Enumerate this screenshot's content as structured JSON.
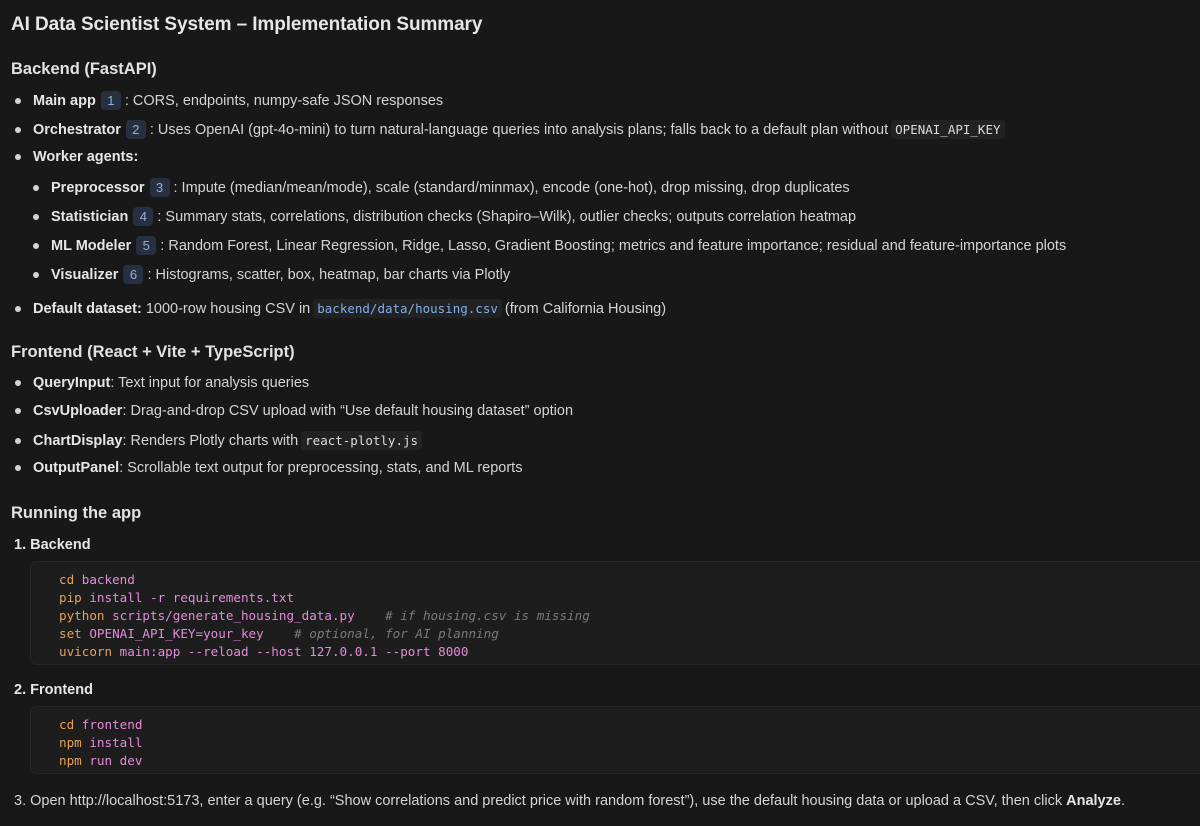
{
  "title": "AI Data Scientist System – Implementation Summary",
  "backend": {
    "heading": "Backend (FastAPI)",
    "items": [
      {
        "label": "Main app",
        "ref": "1",
        "text": ": CORS, endpoints, numpy-safe JSON responses"
      },
      {
        "label": "Orchestrator",
        "ref": "2",
        "text": ": Uses OpenAI (gpt-4o-mini) to turn natural-language queries into analysis plans; falls back to a default plan without",
        "code": "OPENAI_API_KEY"
      },
      {
        "label": "Worker agents:"
      }
    ],
    "workers": [
      {
        "label": "Preprocessor",
        "ref": "3",
        "text": ": Impute (median/mean/mode), scale (standard/minmax), encode (one-hot), drop missing, drop duplicates"
      },
      {
        "label": "Statistician",
        "ref": "4",
        "text": ": Summary stats, correlations, distribution checks (Shapiro–Wilk), outlier checks; outputs correlation heatmap"
      },
      {
        "label": "ML Modeler",
        "ref": "5",
        "text": ": Random Forest, Linear Regression, Ridge, Lasso, Gradient Boosting; metrics and feature importance; residual and feature-importance plots"
      },
      {
        "label": "Visualizer",
        "ref": "6",
        "text": ": Histograms, scatter, box, heatmap, bar charts via Plotly"
      }
    ],
    "dataset": {
      "label": "Default dataset:",
      "text1": "1000-row housing CSV in",
      "code": "backend/data/housing.csv",
      "text2": "(from California Housing)"
    }
  },
  "frontend": {
    "heading": "Frontend (React + Vite + TypeScript)",
    "items": [
      {
        "label": "QueryInput",
        "text": ": Text input for analysis queries"
      },
      {
        "label": "CsvUploader",
        "text": ": Drag-and-drop CSV upload with “Use default housing dataset” option"
      },
      {
        "label": "ChartDisplay",
        "text": ": Renders Plotly charts with",
        "code": "react-plotly.js"
      },
      {
        "label": "OutputPanel",
        "text": ": Scrollable text output for preprocessing, stats, and ML reports"
      }
    ]
  },
  "running": {
    "heading": "Running the app",
    "step1": "1. Backend",
    "backend_code": [
      {
        "cmd": "cd backend",
        "comment": ""
      },
      {
        "cmd": "pip install -r requirements.txt",
        "comment": ""
      },
      {
        "cmd": "python scripts/generate_housing_data.py",
        "comment": "# if housing.csv is missing"
      },
      {
        "cmd": "set OPENAI_API_KEY=your_key",
        "comment": "# optional, for AI planning"
      },
      {
        "cmd": "uvicorn main:app --reload --host 127.0.0.1 --port 8000",
        "comment": ""
      }
    ],
    "step2": "2. Frontend",
    "frontend_code": [
      "cd frontend",
      "npm install",
      "npm run dev"
    ],
    "step3_text": "3. Open http://localhost:5173, enter a query (e.g. “Show correlations and predict price with random forest”), use the default housing data or upload a CSV, then click",
    "step3_bold": "Analyze",
    "step3_end": "."
  },
  "colors": {
    "background": "#181818",
    "text": "#d4d4d4",
    "code_keyword": "#e6a15a",
    "code_arg": "#e38bd8",
    "code_comment": "#7a7a7a",
    "ref_badge": "#263040"
  }
}
